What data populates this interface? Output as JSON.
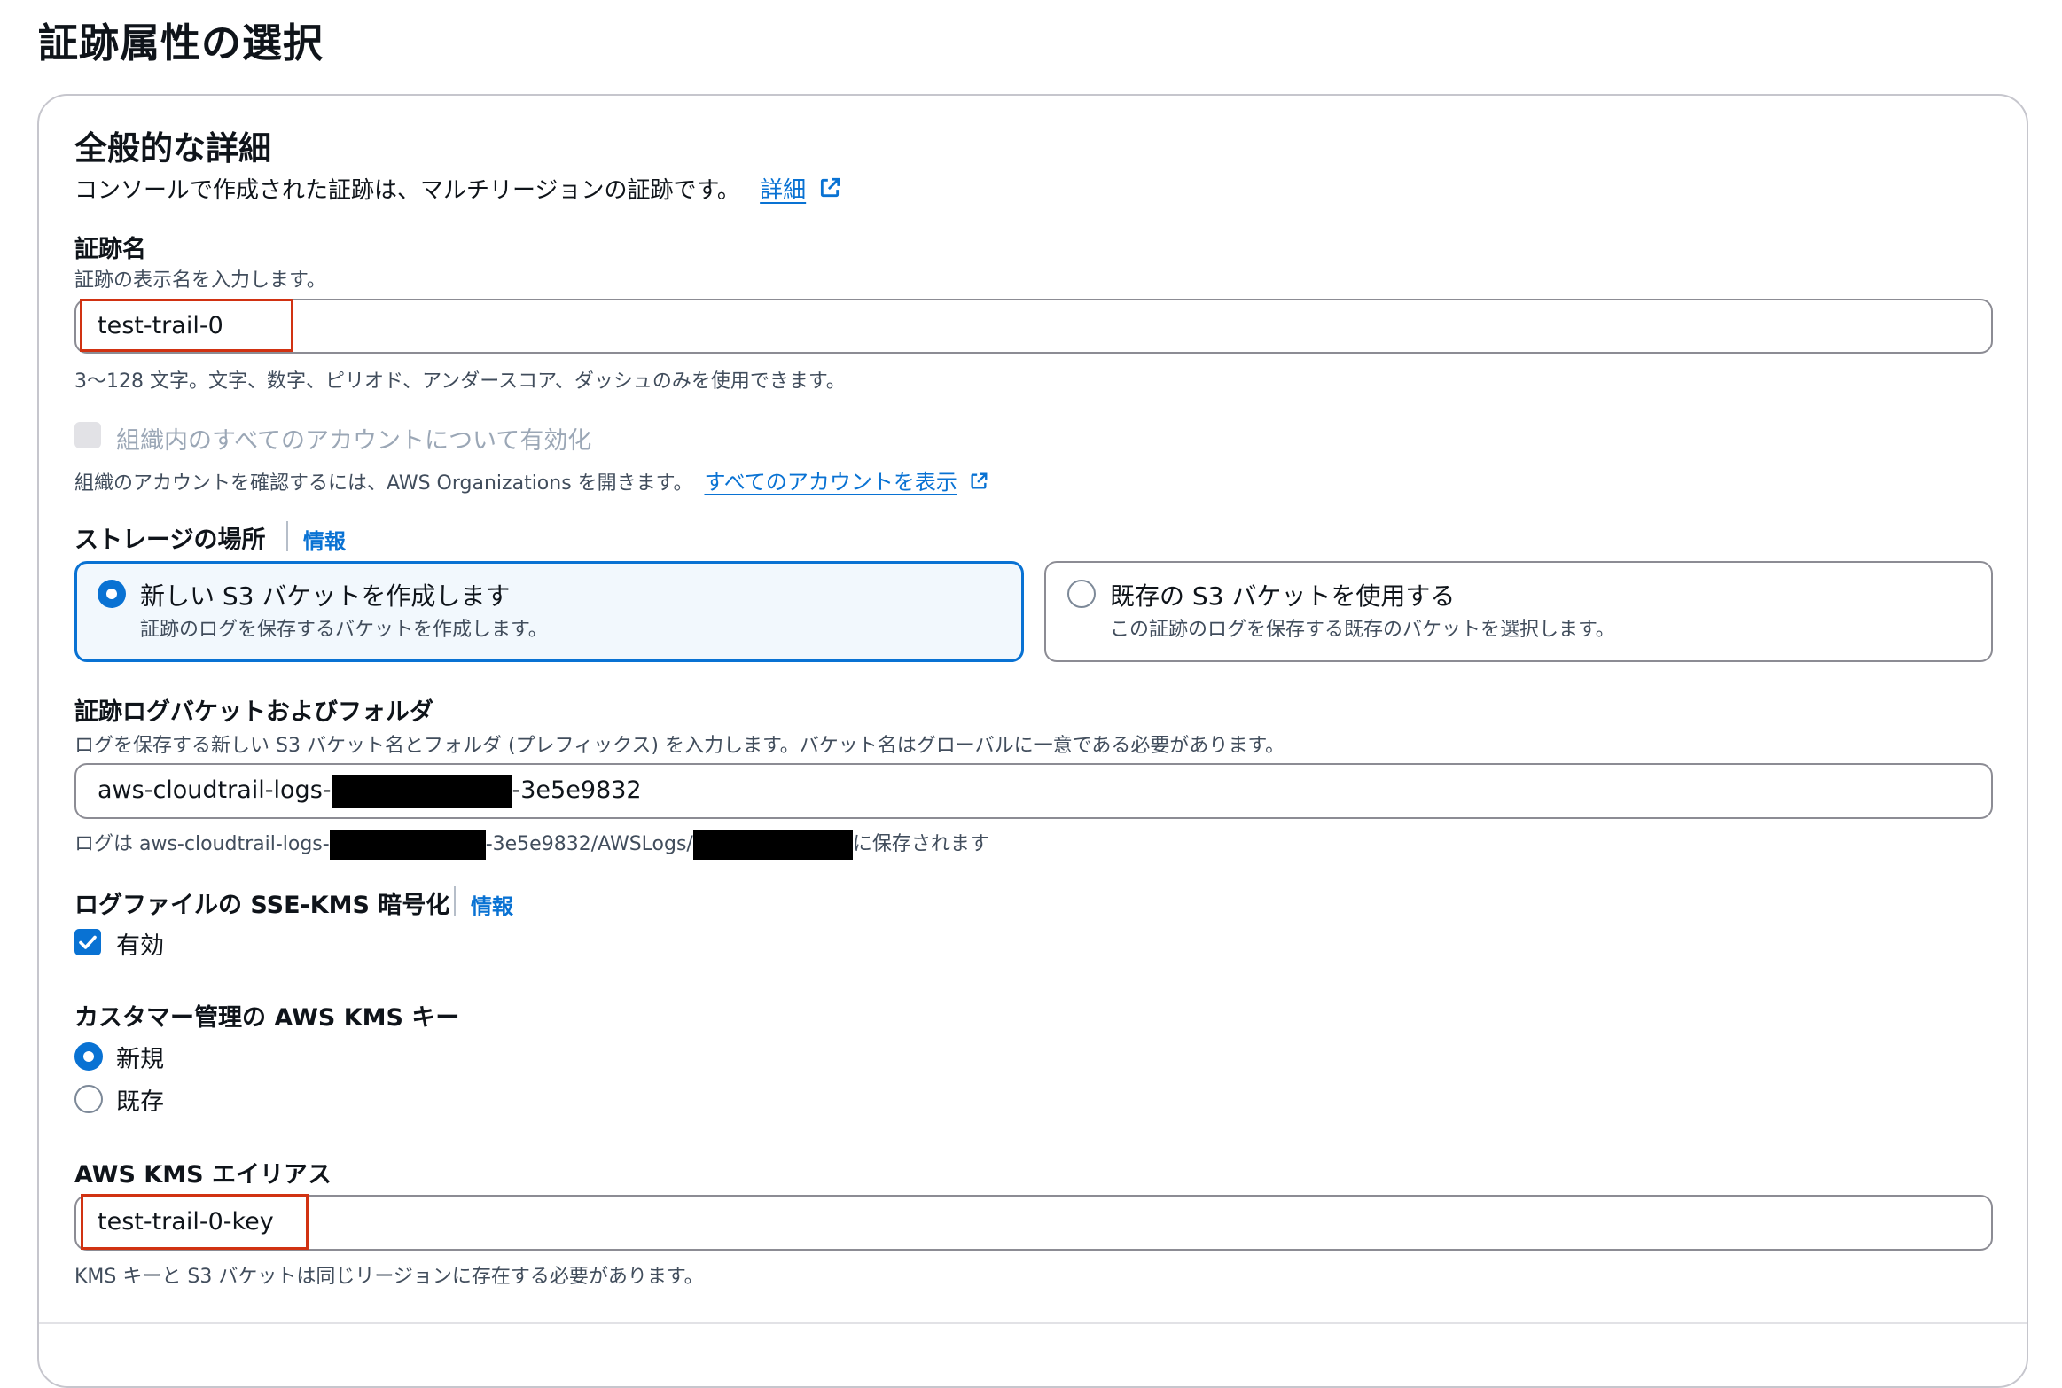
{
  "page_title": "証跡属性の選択",
  "general": {
    "heading": "全般的な詳細",
    "description": "コンソールで作成された証跡は、マルチリージョンの証跡です。",
    "learn_more_link": "詳細",
    "trail_name": {
      "label": "証跡名",
      "description": "証跡の表示名を入力します。",
      "value": "test-trail-0",
      "constraint": "3〜128 文字。文字、数字、ピリオド、アンダースコア、ダッシュのみを使用できます。"
    },
    "organization": {
      "checkbox_label": "組織内のすべてのアカウントについて有効化",
      "checked": false,
      "disabled": true,
      "description": "組織のアカウントを確認するには、AWS Organizations を開きます。",
      "link": "すべてのアカウントを表示"
    },
    "storage_location": {
      "label": "ストレージの場所",
      "info": "情報",
      "options": [
        {
          "title": "新しい S3 バケットを作成します",
          "description": "証跡のログを保存するバケットを作成します。",
          "selected": true
        },
        {
          "title": "既存の S3 バケットを使用する",
          "description": "この証跡のログを保存する既存のバケットを選択します。",
          "selected": false
        }
      ]
    },
    "bucket": {
      "label": "証跡ログバケットおよびフォルダ",
      "description": "ログを保存する新しい S3 バケット名とフォルダ (プレフィックス) を入力します。バケット名はグローバルに一意である必要があります。",
      "value_prefix": "aws-cloudtrail-logs-",
      "value_suffix": "-3e5e9832",
      "hint_prefix": "ログは aws-cloudtrail-logs-",
      "hint_middle": "-3e5e9832/AWSLogs/",
      "hint_suffix": "に保存されます"
    },
    "sse_kms": {
      "label": "ログファイルの SSE-KMS 暗号化",
      "info": "情報",
      "checkbox_label": "有効",
      "checked": true
    },
    "cmk": {
      "label": "カスタマー管理の AWS KMS キー",
      "options": [
        {
          "label": "新規",
          "selected": true
        },
        {
          "label": "既存",
          "selected": false
        }
      ]
    },
    "kms_alias": {
      "label": "AWS KMS エイリアス",
      "value": "test-trail-0-key",
      "hint": "KMS キーと S3 バケットは同じリージョンに存在する必要があります。"
    }
  },
  "colors": {
    "accent": "#0972d3",
    "highlight": "#d13212",
    "redaction": "#000000"
  }
}
